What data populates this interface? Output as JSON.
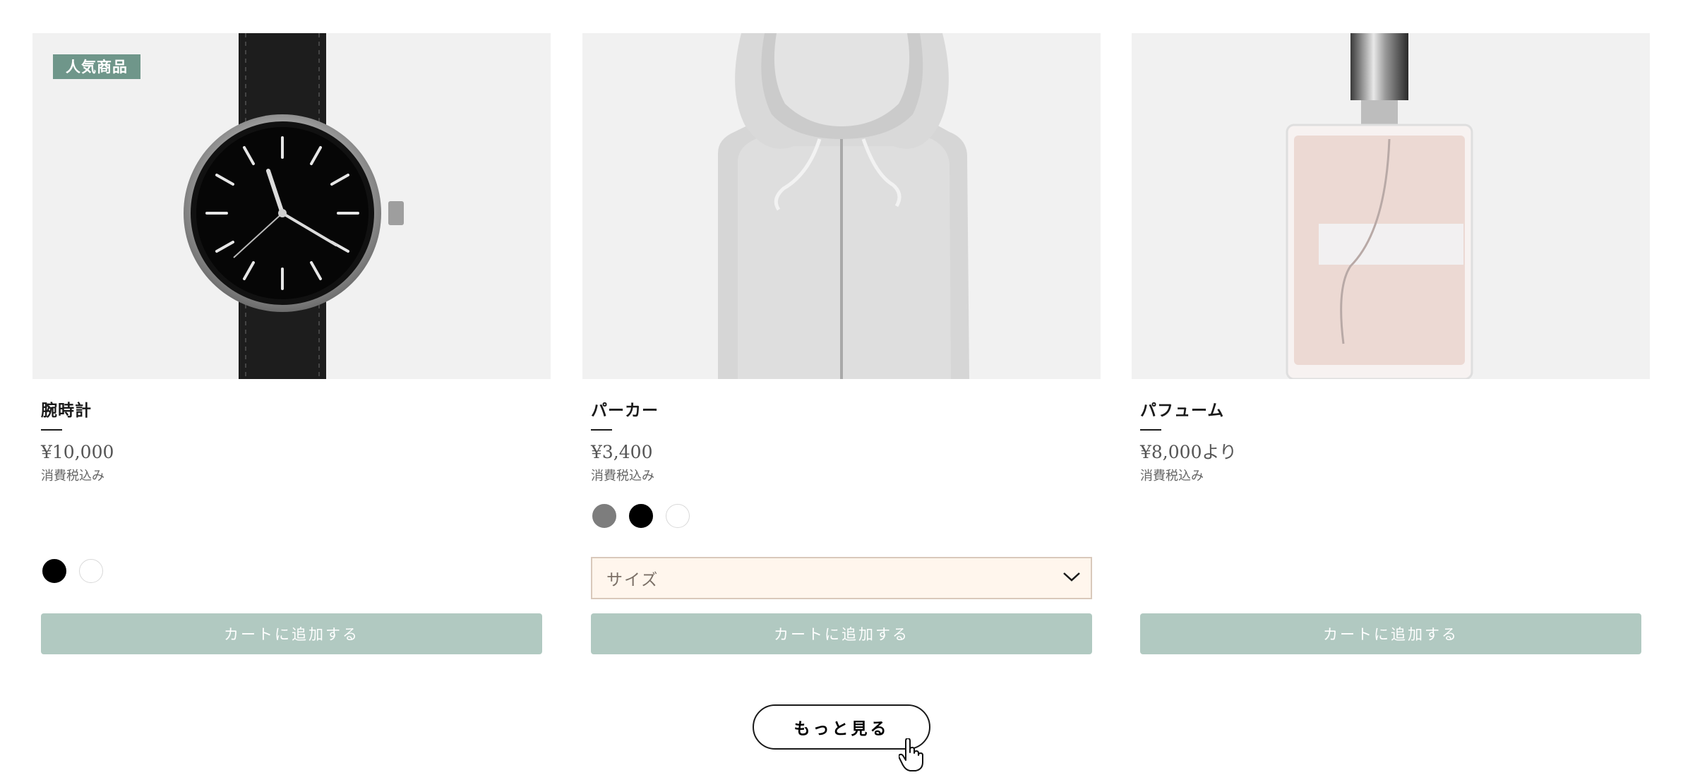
{
  "products": [
    {
      "badge": "人気商品",
      "name": "腕時計",
      "price": "¥10,000",
      "tax_note": "消費税込み",
      "image": "wristwatch-image",
      "swatches": [
        "black",
        "white"
      ],
      "cart_label": "カートに追加する"
    },
    {
      "name": "パーカー",
      "price": "¥3,400",
      "tax_note": "消費税込み",
      "image": "hoodie-image",
      "swatches": [
        "gray",
        "black",
        "white"
      ],
      "size_select": {
        "placeholder": "サイズ"
      },
      "cart_label": "カートに追加する"
    },
    {
      "name": "パフューム",
      "price": "¥8,000より",
      "tax_note": "消費税込み",
      "image": "perfume-image",
      "cart_label": "カートに追加する"
    }
  ],
  "load_more_label": "もっと見る",
  "colors": {
    "badge": "#6f968a",
    "cart_button": "#b1c9c1",
    "select_bg": "#fff6ed",
    "swatch_gray": "#7d7d7d",
    "swatch_black": "#000000",
    "swatch_white": "#ffffff"
  }
}
